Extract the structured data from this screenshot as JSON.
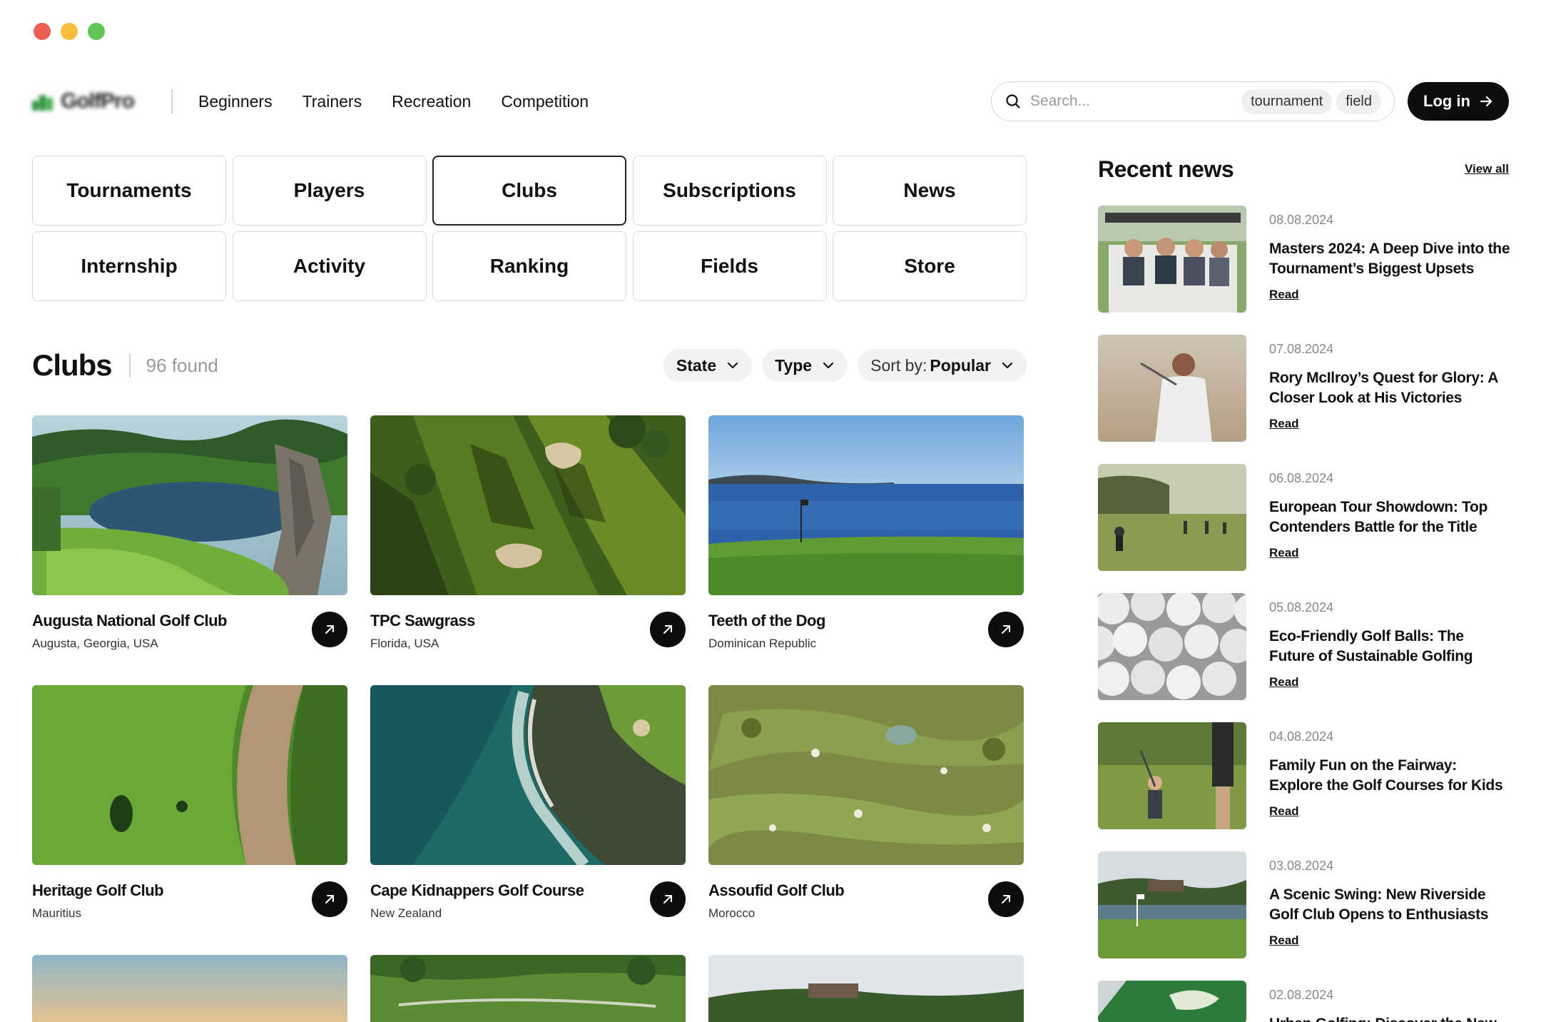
{
  "window": {
    "controls": [
      {
        "name": "close",
        "color": "#ee5e54"
      },
      {
        "name": "minimize",
        "color": "#f6bd3b"
      },
      {
        "name": "zoom",
        "color": "#5fc453"
      }
    ]
  },
  "brand": {
    "name": "GolfPro"
  },
  "nav": {
    "items": [
      "Beginners",
      "Trainers",
      "Recreation",
      "Competition"
    ]
  },
  "search": {
    "placeholder": "Search...",
    "chips": [
      "tournament",
      "field"
    ]
  },
  "login": {
    "label": "Log in"
  },
  "categories": {
    "items": [
      "Tournaments",
      "Players",
      "Clubs",
      "Subscriptions",
      "News",
      "Internship",
      "Activity",
      "Ranking",
      "Fields",
      "Store"
    ],
    "active": "Clubs"
  },
  "clubs": {
    "title": "Clubs",
    "count": "96 found",
    "filters": {
      "state": "State",
      "type": "Type",
      "sort_prefix": "Sort by:",
      "sort_value": "Popular"
    },
    "items": [
      {
        "name": "Augusta National Golf Club",
        "location": "Augusta, Georgia, USA"
      },
      {
        "name": "TPC Sawgrass",
        "location": "Florida, USA"
      },
      {
        "name": "Teeth of the Dog",
        "location": "Dominican Republic"
      },
      {
        "name": "Heritage Golf Club",
        "location": "Mauritius"
      },
      {
        "name": "Cape Kidnappers Golf Course",
        "location": "New Zealand"
      },
      {
        "name": "Assoufid Golf Club",
        "location": "Morocco"
      }
    ]
  },
  "news": {
    "title": "Recent news",
    "view_all": "View all",
    "read_label": "Read",
    "items": [
      {
        "date": "08.08.2024",
        "headline": "Masters 2024: A Deep Dive into the Tournament’s Biggest Upsets"
      },
      {
        "date": "07.08.2024",
        "headline": "Rory McIlroy’s Quest for Glory: A Closer Look at His Victories"
      },
      {
        "date": "06.08.2024",
        "headline": "European Tour Showdown: Top Contenders Battle for the Title"
      },
      {
        "date": "05.08.2024",
        "headline": "Eco-Friendly Golf Balls: The Future of Sustainable Golfing"
      },
      {
        "date": "04.08.2024",
        "headline": "Family Fun on the Fairway: Explore the Golf Courses for Kids"
      },
      {
        "date": "03.08.2024",
        "headline": "A Scenic Swing: New Riverside Golf Club Opens to Enthusiasts"
      },
      {
        "date": "02.08.2024",
        "headline": "Urban Golfing: Discover the New"
      }
    ]
  }
}
